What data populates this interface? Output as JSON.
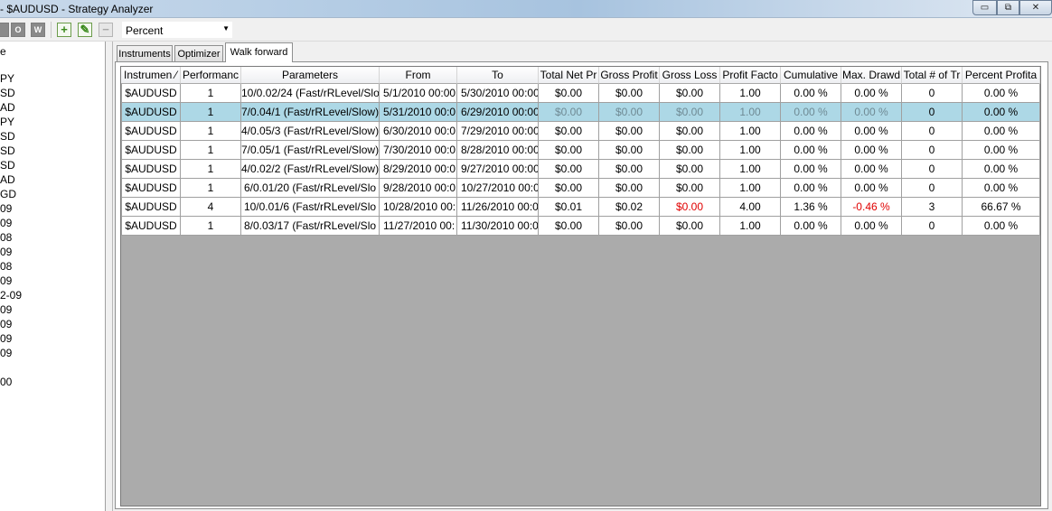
{
  "window": {
    "title": "- $AUDUSD - Strategy Analyzer",
    "min_label": "▭",
    "max_label": "⧉",
    "close_label": "✕"
  },
  "toolbar": {
    "btn1_label": "",
    "btn2_label": "O",
    "btn3_label": "W",
    "add_label": "+",
    "edit_label": "✎",
    "remove_label": "−",
    "display_mode": "Percent",
    "dropdown_arrow": "▼"
  },
  "left_panel": {
    "items": [
      "e",
      "PY",
      "SD",
      "AD",
      "PY",
      "SD",
      "SD",
      "SD",
      "AD",
      "GD",
      "09",
      "09",
      "08",
      "09",
      "08",
      "09",
      "2-09",
      "09",
      "09",
      "09",
      "09",
      "00"
    ]
  },
  "tabs": [
    {
      "label": "Instruments"
    },
    {
      "label": "Optimizer"
    },
    {
      "label": "Walk forward"
    }
  ],
  "table": {
    "columns": [
      "Instrumen",
      "Performanc",
      "Parameters",
      "From",
      "To",
      "Total Net Pr",
      "Gross Profit",
      "Gross Loss",
      "Profit Facto",
      "Cumulative",
      "Max. Drawd",
      "Total # of Tr",
      "Percent Profita"
    ],
    "sort_indicator": "⁄",
    "rows": [
      [
        "$AUDUSD",
        "1",
        "10/0.02/24 (Fast/rRLevel/Slo",
        "5/1/2010 00:00:",
        "5/30/2010 00:00",
        "$0.00",
        "$0.00",
        "$0.00",
        "1.00",
        "0.00 %",
        "0.00 %",
        "0",
        "0.00 %"
      ],
      [
        "$AUDUSD",
        "1",
        "7/0.04/1 (Fast/rRLevel/Slow)",
        "5/31/2010 00:0",
        "6/29/2010 00:00",
        "$0.00",
        "$0.00",
        "$0.00",
        "1.00",
        "0.00 %",
        "0.00 %",
        "0",
        "0.00 %"
      ],
      [
        "$AUDUSD",
        "1",
        "4/0.05/3 (Fast/rRLevel/Slow)",
        "6/30/2010 00:0",
        "7/29/2010 00:00",
        "$0.00",
        "$0.00",
        "$0.00",
        "1.00",
        "0.00 %",
        "0.00 %",
        "0",
        "0.00 %"
      ],
      [
        "$AUDUSD",
        "1",
        "7/0.05/1 (Fast/rRLevel/Slow)",
        "7/30/2010 00:0",
        "8/28/2010 00:00",
        "$0.00",
        "$0.00",
        "$0.00",
        "1.00",
        "0.00 %",
        "0.00 %",
        "0",
        "0.00 %"
      ],
      [
        "$AUDUSD",
        "1",
        "4/0.02/2 (Fast/rRLevel/Slow)",
        "8/29/2010 00:0",
        "9/27/2010 00:00",
        "$0.00",
        "$0.00",
        "$0.00",
        "1.00",
        "0.00 %",
        "0.00 %",
        "0",
        "0.00 %"
      ],
      [
        "$AUDUSD",
        "1",
        "6/0.01/20 (Fast/rRLevel/Slo",
        "9/28/2010 00:0",
        "10/27/2010 00:0",
        "$0.00",
        "$0.00",
        "$0.00",
        "1.00",
        "0.00 %",
        "0.00 %",
        "0",
        "0.00 %"
      ],
      [
        "$AUDUSD",
        "4",
        "10/0.01/6 (Fast/rRLevel/Slo",
        "10/28/2010 00:",
        "11/26/2010 00:0",
        "$0.01",
        "$0.02",
        "$0.00",
        "4.00",
        "1.36 %",
        "-0.46 %",
        "3",
        "66.67 %"
      ],
      [
        "$AUDUSD",
        "1",
        "8/0.03/17 (Fast/rRLevel/Slo",
        "11/27/2010 00:",
        "11/30/2010 00:0",
        "$0.00",
        "$0.00",
        "$0.00",
        "1.00",
        "0.00 %",
        "0.00 %",
        "0",
        "0.00 %"
      ]
    ],
    "selected_row": 1
  },
  "colors": {
    "selected_row": "#add8e6",
    "negative_value": "#e00000",
    "grid_background": "#ababab"
  }
}
